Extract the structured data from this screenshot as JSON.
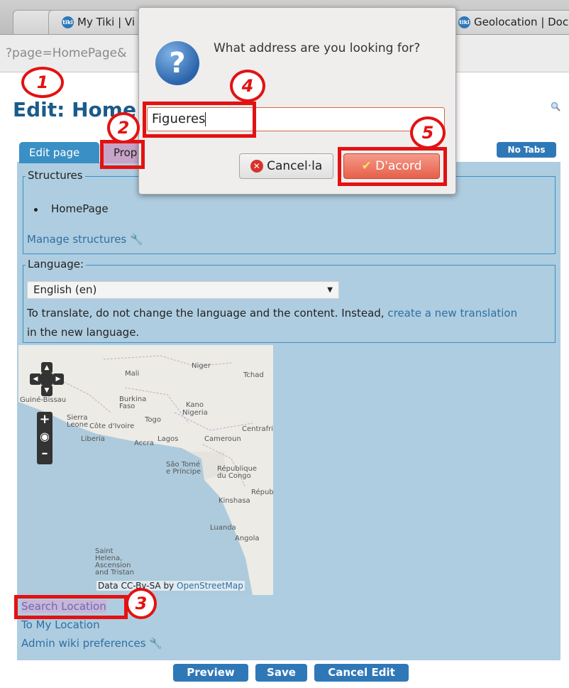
{
  "browser": {
    "tabs": [
      "My Tiki | Vi",
      "Geolocation | Doc"
    ],
    "url_fragment": "?page=HomePage&"
  },
  "page": {
    "title": "Edit: Home",
    "tabs": [
      "Edit page",
      "Prop"
    ],
    "no_tabs_label": "No Tabs",
    "structures": {
      "legend": "Structures",
      "items": [
        "HomePage"
      ],
      "manage_link": "Manage structures"
    },
    "language": {
      "legend": "Language:",
      "selected": "English (en)",
      "help_text": "To translate, do not change the language and the content. Instead,",
      "help_link": "create a new translation",
      "help_suffix": "in the new language."
    },
    "map": {
      "labels": [
        "Mali",
        "Niger",
        "Tchad",
        "Burkina Faso",
        "Kano",
        "Nigeria",
        "Guiné-Bissau",
        "Sierra Leone",
        "Côte d'Ivoire",
        "Togo",
        "Liberia",
        "Accra",
        "Lagos",
        "Cameroun",
        "Centrafri",
        "São Tomé e Príncipe",
        "République du Congo",
        "Républ",
        "Kinshasa",
        "Luanda",
        "Angola",
        "Saint Helena, Ascension and Tristan"
      ],
      "attribution": "Data CC-By-SA by",
      "attribution_link": "OpenStreetMap"
    },
    "links": [
      "Search Location",
      "To My Location",
      "Admin wiki preferences"
    ],
    "buttons": [
      "Preview",
      "Save",
      "Cancel Edit"
    ]
  },
  "dialog": {
    "message": "What address are you looking for?",
    "input_value": "Figueres",
    "cancel_label": "Cancel·la",
    "ok_label": "D'acord"
  },
  "callouts": [
    "1",
    "2",
    "3",
    "4",
    "5"
  ],
  "colors": {
    "accent": "#2f78b8",
    "annotation": "#e31212",
    "panel": "#aecde0"
  }
}
